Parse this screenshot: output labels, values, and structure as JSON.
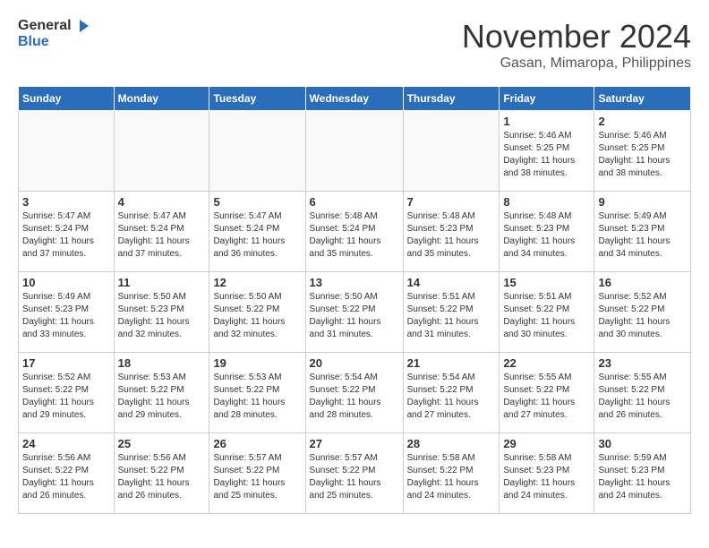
{
  "logo": {
    "general": "General",
    "blue": "Blue"
  },
  "header": {
    "month": "November 2024",
    "location": "Gasan, Mimaropa, Philippines"
  },
  "weekdays": [
    "Sunday",
    "Monday",
    "Tuesday",
    "Wednesday",
    "Thursday",
    "Friday",
    "Saturday"
  ],
  "weeks": [
    [
      {
        "day": "",
        "info": ""
      },
      {
        "day": "",
        "info": ""
      },
      {
        "day": "",
        "info": ""
      },
      {
        "day": "",
        "info": ""
      },
      {
        "day": "",
        "info": ""
      },
      {
        "day": "1",
        "info": "Sunrise: 5:46 AM\nSunset: 5:25 PM\nDaylight: 11 hours\nand 38 minutes."
      },
      {
        "day": "2",
        "info": "Sunrise: 5:46 AM\nSunset: 5:25 PM\nDaylight: 11 hours\nand 38 minutes."
      }
    ],
    [
      {
        "day": "3",
        "info": "Sunrise: 5:47 AM\nSunset: 5:24 PM\nDaylight: 11 hours\nand 37 minutes."
      },
      {
        "day": "4",
        "info": "Sunrise: 5:47 AM\nSunset: 5:24 PM\nDaylight: 11 hours\nand 37 minutes."
      },
      {
        "day": "5",
        "info": "Sunrise: 5:47 AM\nSunset: 5:24 PM\nDaylight: 11 hours\nand 36 minutes."
      },
      {
        "day": "6",
        "info": "Sunrise: 5:48 AM\nSunset: 5:24 PM\nDaylight: 11 hours\nand 35 minutes."
      },
      {
        "day": "7",
        "info": "Sunrise: 5:48 AM\nSunset: 5:23 PM\nDaylight: 11 hours\nand 35 minutes."
      },
      {
        "day": "8",
        "info": "Sunrise: 5:48 AM\nSunset: 5:23 PM\nDaylight: 11 hours\nand 34 minutes."
      },
      {
        "day": "9",
        "info": "Sunrise: 5:49 AM\nSunset: 5:23 PM\nDaylight: 11 hours\nand 34 minutes."
      }
    ],
    [
      {
        "day": "10",
        "info": "Sunrise: 5:49 AM\nSunset: 5:23 PM\nDaylight: 11 hours\nand 33 minutes."
      },
      {
        "day": "11",
        "info": "Sunrise: 5:50 AM\nSunset: 5:23 PM\nDaylight: 11 hours\nand 32 minutes."
      },
      {
        "day": "12",
        "info": "Sunrise: 5:50 AM\nSunset: 5:22 PM\nDaylight: 11 hours\nand 32 minutes."
      },
      {
        "day": "13",
        "info": "Sunrise: 5:50 AM\nSunset: 5:22 PM\nDaylight: 11 hours\nand 31 minutes."
      },
      {
        "day": "14",
        "info": "Sunrise: 5:51 AM\nSunset: 5:22 PM\nDaylight: 11 hours\nand 31 minutes."
      },
      {
        "day": "15",
        "info": "Sunrise: 5:51 AM\nSunset: 5:22 PM\nDaylight: 11 hours\nand 30 minutes."
      },
      {
        "day": "16",
        "info": "Sunrise: 5:52 AM\nSunset: 5:22 PM\nDaylight: 11 hours\nand 30 minutes."
      }
    ],
    [
      {
        "day": "17",
        "info": "Sunrise: 5:52 AM\nSunset: 5:22 PM\nDaylight: 11 hours\nand 29 minutes."
      },
      {
        "day": "18",
        "info": "Sunrise: 5:53 AM\nSunset: 5:22 PM\nDaylight: 11 hours\nand 29 minutes."
      },
      {
        "day": "19",
        "info": "Sunrise: 5:53 AM\nSunset: 5:22 PM\nDaylight: 11 hours\nand 28 minutes."
      },
      {
        "day": "20",
        "info": "Sunrise: 5:54 AM\nSunset: 5:22 PM\nDaylight: 11 hours\nand 28 minutes."
      },
      {
        "day": "21",
        "info": "Sunrise: 5:54 AM\nSunset: 5:22 PM\nDaylight: 11 hours\nand 27 minutes."
      },
      {
        "day": "22",
        "info": "Sunrise: 5:55 AM\nSunset: 5:22 PM\nDaylight: 11 hours\nand 27 minutes."
      },
      {
        "day": "23",
        "info": "Sunrise: 5:55 AM\nSunset: 5:22 PM\nDaylight: 11 hours\nand 26 minutes."
      }
    ],
    [
      {
        "day": "24",
        "info": "Sunrise: 5:56 AM\nSunset: 5:22 PM\nDaylight: 11 hours\nand 26 minutes."
      },
      {
        "day": "25",
        "info": "Sunrise: 5:56 AM\nSunset: 5:22 PM\nDaylight: 11 hours\nand 26 minutes."
      },
      {
        "day": "26",
        "info": "Sunrise: 5:57 AM\nSunset: 5:22 PM\nDaylight: 11 hours\nand 25 minutes."
      },
      {
        "day": "27",
        "info": "Sunrise: 5:57 AM\nSunset: 5:22 PM\nDaylight: 11 hours\nand 25 minutes."
      },
      {
        "day": "28",
        "info": "Sunrise: 5:58 AM\nSunset: 5:22 PM\nDaylight: 11 hours\nand 24 minutes."
      },
      {
        "day": "29",
        "info": "Sunrise: 5:58 AM\nSunset: 5:23 PM\nDaylight: 11 hours\nand 24 minutes."
      },
      {
        "day": "30",
        "info": "Sunrise: 5:59 AM\nSunset: 5:23 PM\nDaylight: 11 hours\nand 24 minutes."
      }
    ]
  ]
}
